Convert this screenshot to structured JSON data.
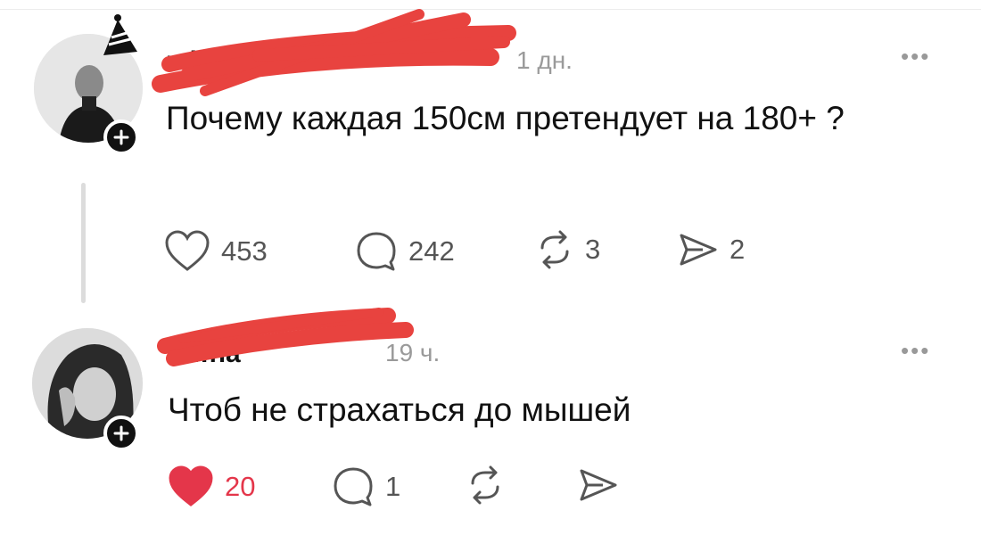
{
  "posts": [
    {
      "username": "mi…",
      "time": "1 дн.",
      "text": "Почему каждая 150см претендует на 180+ ?",
      "more_label": "•••",
      "actions": {
        "likes": "453",
        "replies": "242",
        "reposts": "3",
        "shares": "2"
      },
      "liked": false
    },
    {
      "username": "a…na",
      "time": "19 ч.",
      "text": "Чтоб не страхаться до мышей",
      "more_label": "•••",
      "actions": {
        "likes": "20",
        "replies": "1"
      },
      "liked": true
    }
  ],
  "colors": {
    "like_active": "#e4364a",
    "redaction": "#e8433f",
    "icon": "#555555"
  },
  "icons": [
    "heart-icon",
    "comment-icon",
    "repost-icon",
    "share-icon",
    "plus-icon",
    "more-icon"
  ]
}
